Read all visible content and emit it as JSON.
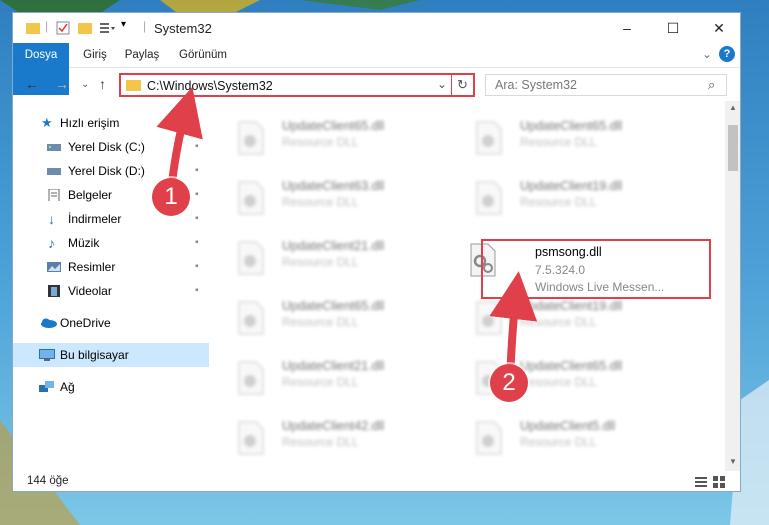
{
  "titlebar": {
    "title": "System32",
    "minimize_glyph": "–",
    "maximize_glyph": "☐",
    "close_glyph": "✕"
  },
  "ribbon": {
    "tabs": [
      {
        "label": "Dosya",
        "active": true
      },
      {
        "label": "Giriş"
      },
      {
        "label": "Paylaş"
      },
      {
        "label": "Görünüm"
      }
    ],
    "expand_glyph": "⌄",
    "help_glyph": "?"
  },
  "nav": {
    "back_glyph": "←",
    "forward_glyph": "→",
    "recent_glyph": "⌄",
    "up_glyph": "↑",
    "address": "C:\\Windows\\System32",
    "dropdown_glyph": "⌄",
    "refresh_glyph": "↻",
    "search_placeholder": "Ara: System32",
    "search_glyph": "⌕"
  },
  "sidebar": {
    "items": [
      {
        "label": "Hızlı erişim",
        "icon": "star-icon",
        "pinned": false
      },
      {
        "label": "Yerel Disk (C:)",
        "icon": "drive-icon",
        "pinned": true
      },
      {
        "label": "Yerel Disk (D:)",
        "icon": "drive-icon",
        "pinned": true
      },
      {
        "label": "Belgeler",
        "icon": "documents-icon",
        "pinned": true
      },
      {
        "label": "İndirmeler",
        "icon": "download-icon",
        "pinned": true
      },
      {
        "label": "Müzik",
        "icon": "music-icon",
        "pinned": true
      },
      {
        "label": "Resimler",
        "icon": "pictures-icon",
        "pinned": true
      },
      {
        "label": "Videolar",
        "icon": "videos-icon",
        "pinned": true
      },
      {
        "label": "OneDrive",
        "icon": "cloud-icon",
        "pinned": false
      },
      {
        "label": "Bu bilgisayar",
        "icon": "computer-icon",
        "pinned": false,
        "selected": true
      },
      {
        "label": "Ağ",
        "icon": "network-icon",
        "pinned": false
      }
    ],
    "pin_glyph": "📌"
  },
  "files": {
    "left": [
      {
        "name": "UpdateClient65.dll",
        "desc": "Resource DLL"
      },
      {
        "name": "UpdateClient63.dll",
        "desc": "Resource DLL"
      },
      {
        "name": "UpdateClient21.dll",
        "desc": "Resource DLL"
      },
      {
        "name": "UpdateClient65.dll",
        "desc": "Resource DLL"
      },
      {
        "name": "UpdateClient21.dll",
        "desc": "Resource DLL"
      },
      {
        "name": "UpdateClient42.dll",
        "desc": "Resource DLL"
      }
    ],
    "right": [
      {
        "name": "UpdateClient65.dll",
        "desc": "Resource DLL"
      },
      {
        "name": "UpdateClient19.dll",
        "desc": "Resource DLL"
      },
      {
        "name": "psmsong.dll",
        "version": "7.5.324.0",
        "desc": "Windows Live Messen...",
        "highlighted": true
      },
      {
        "name": "UpdateClient19.dll",
        "desc": "Resource DLL"
      },
      {
        "name": "UpdateClient65.dll",
        "desc": "Resource DLL"
      },
      {
        "name": "UpdateClient5.dll",
        "desc": "Resource DLL"
      }
    ]
  },
  "status": {
    "count": "144 öğe"
  },
  "annotations": {
    "step1": "1",
    "step2": "2"
  },
  "colors": {
    "accent": "#1979ca",
    "highlight": "#e0404a",
    "selection": "#cce8ff"
  }
}
